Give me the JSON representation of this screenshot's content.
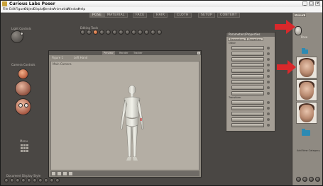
{
  "window": {
    "title": "Curious Labs Poser",
    "controls": [
      "_",
      "□",
      "×"
    ]
  },
  "menu": [
    "File",
    "Edit",
    "Figure",
    "Object",
    "Display",
    "Render",
    "Animation",
    "Window",
    "Help"
  ],
  "tabs": [
    "POSE",
    "MATERIAL",
    "FACE",
    "HAIR",
    "CLOTH",
    "SETUP",
    "CONTENT"
  ],
  "active_tab": "POSE",
  "left_panel": {
    "light_controls": "Light Controls",
    "editing_tools": "Editing Tools",
    "camera_controls": "Camera Controls",
    "menu_label": "Menu",
    "document_display_style": "Document Display Style"
  },
  "document": {
    "tabs": [
      "Preview",
      "Render",
      "Tracker"
    ],
    "figure_menu": "Figure 1",
    "part_menu": "Left Hand",
    "camera_label": "Main Camera"
  },
  "parameters_panel": {
    "title": "Parameters/Properties",
    "tabs": [
      "Parameters",
      "Properties"
    ],
    "section_1": "Other",
    "section_2": "Transform"
  },
  "library": {
    "header": "Library",
    "category": "Pose",
    "folder_label": "Add New Category"
  },
  "colors": {
    "arrow": "#d9282b",
    "workspace": "#4a4744",
    "library_bg": "#8f8a82"
  },
  "icons": {
    "menu": "grid-icon",
    "folder": "folder-icon",
    "arrow": "red-arrow-icon"
  }
}
